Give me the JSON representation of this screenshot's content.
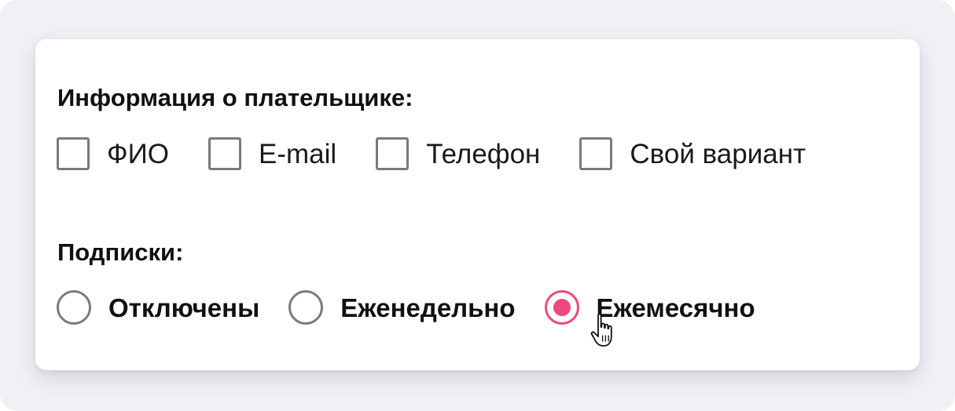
{
  "payer_section": {
    "title": "Информация о плательщике:",
    "options": [
      {
        "label": "ФИО",
        "checked": false
      },
      {
        "label": "E-mail",
        "checked": false
      },
      {
        "label": "Телефон",
        "checked": false
      },
      {
        "label": "Свой вариант",
        "checked": false
      }
    ]
  },
  "subscriptions_section": {
    "title": "Подписки:",
    "options": [
      {
        "label": "Отключены",
        "selected": false
      },
      {
        "label": "Еженедельно",
        "selected": false
      },
      {
        "label": "Ежемесячно",
        "selected": true
      }
    ]
  },
  "colors": {
    "accent": "#f0487e",
    "control_border": "#7a7a7a",
    "background": "#f0f1f5",
    "card": "#ffffff"
  },
  "icons": {
    "cursor": "hand-pointer-icon"
  }
}
